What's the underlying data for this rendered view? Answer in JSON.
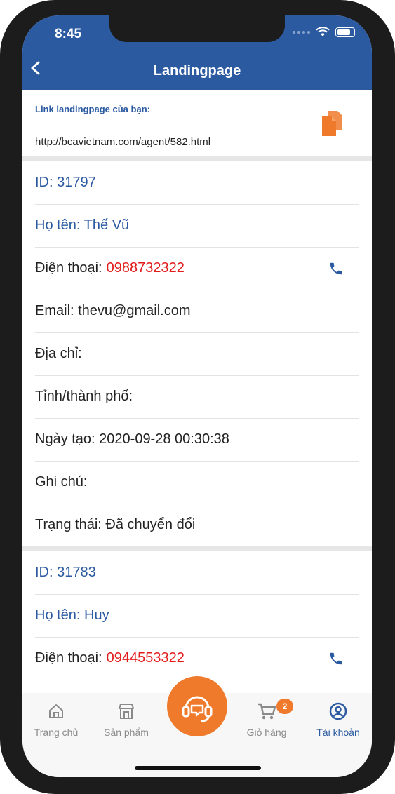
{
  "status_bar": {
    "time": "8:45"
  },
  "header": {
    "title": "Landingpage"
  },
  "link_section": {
    "label": "Link landingpage của bạn:",
    "url": "http://bcavietnam.com/agent/582.html"
  },
  "leads": [
    {
      "id": "ID: 31797",
      "name": "Họ tên: Thế Vũ",
      "phone_label": "Điện thoại:",
      "phone": "0988732322",
      "email": "Email: thevu@gmail.com",
      "address": "Địa chỉ:",
      "city": "Tỉnh/thành phố:",
      "created": "Ngày tạo: 2020-09-28 00:30:38",
      "note": "Ghi chú:",
      "status": "Trạng thái: Đã chuyển đổi"
    },
    {
      "id": "ID: 31783",
      "name": "Họ tên: Huy",
      "phone_label": "Điện thoại:",
      "phone": "0944553322"
    }
  ],
  "tabbar": {
    "home": "Trang chủ",
    "products": "Sản phẩm",
    "cart": "Giỏ hàng",
    "cart_badge": "2",
    "account": "Tài khoản"
  },
  "colors": {
    "primary": "#2b5aa1",
    "accent": "#f07a2b",
    "phone_number": "#e21b1b"
  },
  "icons": [
    "back-arrow-icon",
    "copy-icon",
    "phone-icon",
    "home-icon",
    "store-icon",
    "support-headset-icon",
    "cart-icon",
    "account-icon",
    "wifi-icon",
    "battery-icon"
  ]
}
